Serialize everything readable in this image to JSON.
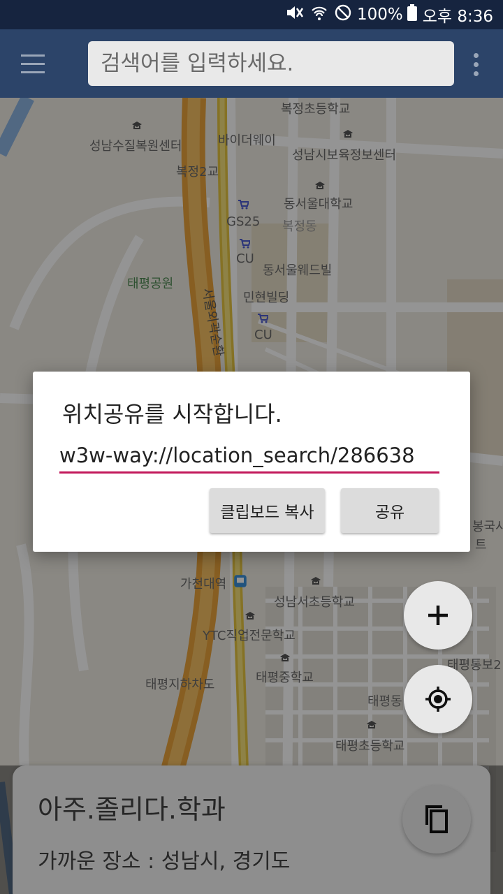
{
  "status_bar": {
    "battery_percent": "100%",
    "time": "오후 8:36"
  },
  "app_bar": {
    "search_placeholder": "검색어를 입력하세요."
  },
  "map": {
    "labels": [
      "복정초등학교",
      "성남수질복원센터",
      "바이더웨이",
      "성남시보육정보센터",
      "복정2교",
      "동서울대학교",
      "GS25",
      "복정동",
      "CU",
      "동서울웨드빌",
      "태평공원",
      "민현빌딩",
      "CU",
      "서울외곽순환",
      "가천대역",
      "성남서초등학교",
      "YTC직업전문학교",
      "태평통보2",
      "태평지하차도",
      "태평중학교",
      "태평동",
      "태평초등학교",
      "봉국사",
      "트"
    ]
  },
  "dialog": {
    "title": "위치공유를 시작합니다.",
    "url_value": "w3w-way://location_search/286638",
    "copy_button": "클립보드 복사",
    "share_button": "공유"
  },
  "bottom_card": {
    "three_words": "아주.졸리다.학과",
    "nearby": "가까운 장소 :  성남시, 경기도"
  },
  "icons": {
    "menu": "hamburger-menu-icon",
    "more": "more-vert-icon",
    "zoom_in": "plus-icon",
    "my_location": "gps-target-icon",
    "copy": "copy-icon"
  }
}
